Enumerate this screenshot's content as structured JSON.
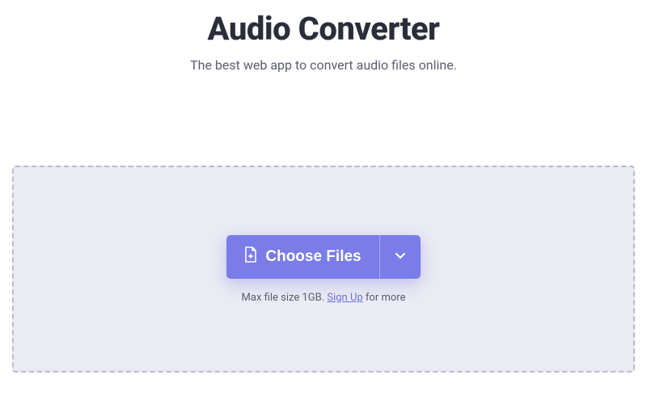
{
  "header": {
    "title": "Audio Converter",
    "subtitle": "The best web app to convert audio files online."
  },
  "dropzone": {
    "choose_label": "Choose Files",
    "hint_prefix": "Max file size 1GB. ",
    "signup_label": "Sign Up",
    "hint_suffix": " for more"
  },
  "colors": {
    "accent": "#7a7ce8",
    "text_dark": "#2b2d3a",
    "text_muted": "#5a5d6d",
    "dropzone_bg": "#ebebf3",
    "dropzone_border": "#b8bacb"
  },
  "icons": {
    "file_add": "file-add-icon",
    "chevron_down": "chevron-down-icon"
  }
}
